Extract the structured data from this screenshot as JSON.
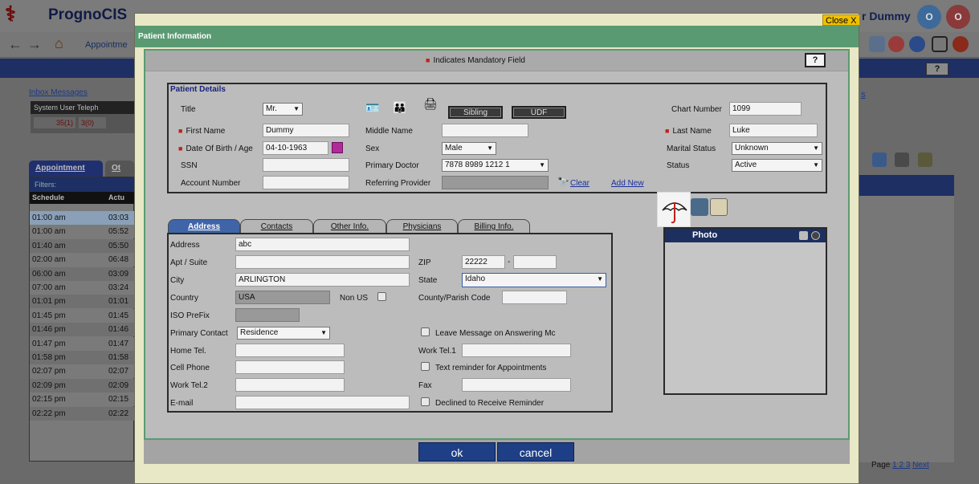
{
  "app": {
    "brand": "PrognoCIS",
    "username_fragment": "r Dummy",
    "avatars": [
      "O",
      "O"
    ],
    "nav_link": "Appointme",
    "inbox_link": "Inbox Messages",
    "mini_headers": "System  User  Teleph",
    "mini_counts": [
      "35(1)",
      "3(0)"
    ],
    "tabs": [
      "Appointment",
      "Ot"
    ],
    "grid_filter": "Filters:",
    "grid_headers": [
      "Schedule",
      "Actu"
    ],
    "schedule_rows": [
      {
        "time": "01:00 am",
        "actual": "03:03"
      },
      {
        "time": "01:00 am",
        "actual": "05:52"
      },
      {
        "time": "01:40 am",
        "actual": "05:50"
      },
      {
        "time": "02:00 am",
        "actual": "06:48"
      },
      {
        "time": "06:00 am",
        "actual": "03:09"
      },
      {
        "time": "07:00 am",
        "actual": "03:24"
      },
      {
        "time": "01:01 pm",
        "actual": "01:01"
      },
      {
        "time": "01:45 pm",
        "actual": "01:45"
      },
      {
        "time": "01:46 pm",
        "actual": "01:46"
      },
      {
        "time": "01:47 pm",
        "actual": "01:47"
      },
      {
        "time": "01:58 pm",
        "actual": "01:58"
      },
      {
        "time": "02:07 pm",
        "actual": "02:07"
      },
      {
        "time": "02:09 pm",
        "actual": "02:09"
      },
      {
        "time": "02:15 pm",
        "actual": "02:15"
      },
      {
        "time": "02:22 pm",
        "actual": "02:22"
      }
    ],
    "right_link": "s",
    "pager_label": "Page",
    "pager_pages": "1 2 3",
    "pager_next": "Next"
  },
  "modal": {
    "close_label": "Close X",
    "title": "Patient Information",
    "mandatory_note": "Indicates Mandatory Field",
    "help_label": "?",
    "patient_details": {
      "legend": "Patient Details",
      "title_label": "Title",
      "title_value": "Mr.",
      "sibling_button": "Sibling",
      "udf_button": "UDF",
      "chart_number_label": "Chart Number",
      "chart_number_value": "1099",
      "first_name_label": "First Name",
      "first_name_value": "Dummy",
      "middle_name_label": "Middle Name",
      "middle_name_value": "",
      "last_name_label": "Last Name",
      "last_name_value": "Luke",
      "dob_label": "Date Of Birth / Age",
      "dob_value": "04-10-1963",
      "sex_label": "Sex",
      "sex_value": "Male",
      "marital_label": "Marital Status",
      "marital_value": "Unknown",
      "ssn_label": "SSN",
      "ssn_value": "",
      "primary_doctor_label": "Primary Doctor",
      "primary_doctor_value": "7878 8989 1212 1",
      "status_label": "Status",
      "status_value": "Active",
      "account_label": "Account Number",
      "account_value": "",
      "referring_label": "Referring Provider",
      "referring_value": "",
      "clear_link": "Clear",
      "add_new_link": "Add New"
    },
    "tabs": [
      "Address",
      "Contacts",
      "Other Info.",
      "Physicians",
      "Billing Info."
    ],
    "address": {
      "address_label": "Address",
      "address_value": "abc",
      "apt_label": "Apt / Suite",
      "apt_value": "",
      "zip_label": "ZIP",
      "zip_value": "22222",
      "zip_ext_value": "",
      "zip_dash": "-",
      "city_label": "City",
      "city_value": "ARLINGTON",
      "state_label": "State",
      "state_value": "Idaho",
      "country_label": "Country",
      "country_value": "USA",
      "non_us_label": "Non US",
      "county_label": "County/Parish Code",
      "county_value": "",
      "iso_label": "ISO PreFix",
      "iso_value": "",
      "primary_contact_label": "Primary Contact",
      "primary_contact_value": "Residence",
      "leave_message_label": "Leave Message on Answering Mc",
      "home_tel_label": "Home Tel.",
      "home_tel_value": "",
      "work_tel1_label": "Work Tel.1",
      "work_tel1_value": "",
      "cell_label": "Cell Phone",
      "cell_value": "",
      "text_reminder_label": "Text reminder for Appointments",
      "work_tel2_label": "Work Tel.2",
      "work_tel2_value": "",
      "fax_label": "Fax",
      "fax_value": "",
      "email_label": "E-mail",
      "email_value": "",
      "declined_label": "Declined to Receive Reminder"
    },
    "photo_label": "Photo",
    "ok_label": "ok",
    "cancel_label": "cancel"
  },
  "colors": {
    "modal_title_bar": "#5a9a72",
    "active_tab": "#4064a8",
    "mandatory_marker": "#c0201a",
    "footer_button": "#1e3f85",
    "close_button": "#f0c000"
  }
}
